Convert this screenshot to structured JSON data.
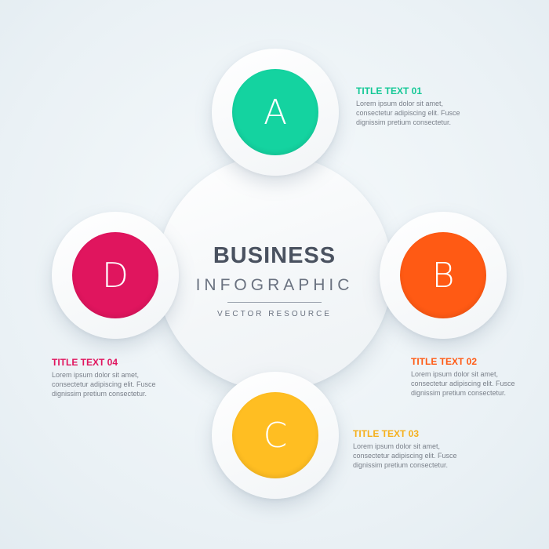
{
  "center": {
    "title": "BUSINESS",
    "subtitle": "INFOGRAPHIC",
    "tagline": "VECTOR RESOURCE"
  },
  "nodes": [
    {
      "letter": "A",
      "color": "#14d3a0"
    },
    {
      "letter": "B",
      "color": "#ff5a14"
    },
    {
      "letter": "C",
      "color": "#ffbe22"
    },
    {
      "letter": "D",
      "color": "#e0155e"
    }
  ],
  "labels": [
    {
      "title": "TITLE TEXT 01",
      "color": "#14c896",
      "lines": [
        "Lorem ipsum dolor sit amet,",
        "consectetur adipiscing elit. Fusce",
        "dignissim pretium consectetur."
      ]
    },
    {
      "title": "TITLE TEXT 02",
      "color": "#ff5a14",
      "lines": [
        "Lorem ipsum dolor sit amet,",
        "consectetur adipiscing elit. Fusce",
        "dignissim pretium consectetur."
      ]
    },
    {
      "title": "TITLE TEXT 03",
      "color": "#f5b01c",
      "lines": [
        "Lorem ipsum dolor sit amet,",
        "consectetur adipiscing elit. Fusce",
        "dignissim pretium consectetur."
      ]
    },
    {
      "title": "TITLE TEXT 04",
      "color": "#e0155e",
      "lines": [
        "Lorem ipsum dolor sit amet,",
        "consectetur adipiscing elit. Fusce",
        "dignissim pretium consectetur."
      ]
    }
  ]
}
